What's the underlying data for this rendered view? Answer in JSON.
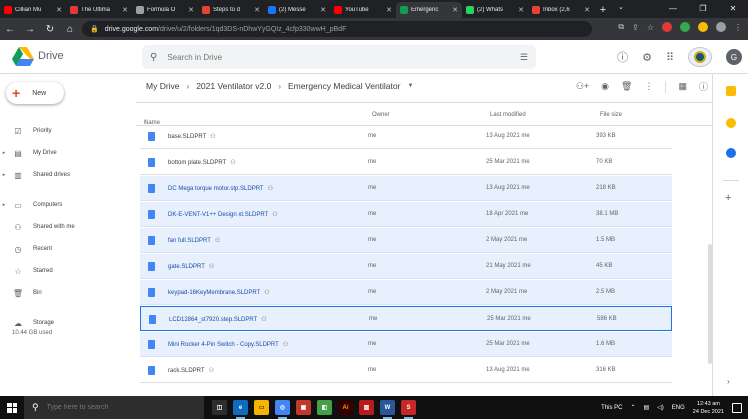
{
  "browser": {
    "tabs": [
      {
        "title": "Cillian Mu",
        "color": "#ff0000",
        "active": false
      },
      {
        "title": "The Ultima",
        "color": "#e53935",
        "active": false
      },
      {
        "title": "Formula O",
        "color": "#9aa0a6",
        "active": false
      },
      {
        "title": "Steps to d",
        "color": "#ea4335",
        "active": false
      },
      {
        "title": "(2) Messe",
        "color": "#1877f2",
        "active": false
      },
      {
        "title": "YouTube",
        "color": "#ff0000",
        "active": false
      },
      {
        "title": "Emergenc",
        "color": "#0f9d58",
        "active": true
      },
      {
        "title": "(2) Whats",
        "color": "#25d366",
        "active": false
      },
      {
        "title": "Inbox (2,6",
        "color": "#ea4335",
        "active": false
      }
    ],
    "url_host": "drive.google.com",
    "url_path": "/drive/u/2/folders/1qd3DS-nDhwYyGQIz_4cfp330wwH_pBdF",
    "window_controls": [
      "—",
      "❐",
      "✕"
    ]
  },
  "drive": {
    "brand": "Drive",
    "search_placeholder": "Search in Drive",
    "avatar_letter": "G"
  },
  "sidebar": {
    "new_label": "New",
    "items": [
      {
        "label": "Priority",
        "icon": "☑",
        "caret": ""
      },
      {
        "label": "My Drive",
        "icon": "▤",
        "caret": "▸"
      },
      {
        "label": "Shared drives",
        "icon": "▥",
        "caret": "▸"
      },
      {
        "label": "Computers",
        "icon": "▭",
        "caret": "▸"
      },
      {
        "label": "Shared with me",
        "icon": "⚇",
        "caret": ""
      },
      {
        "label": "Recent",
        "icon": "◷",
        "caret": ""
      },
      {
        "label": "Starred",
        "icon": "☆",
        "caret": ""
      },
      {
        "label": "Bin",
        "icon": "🗑",
        "caret": ""
      },
      {
        "label": "Storage",
        "icon": "☁",
        "caret": ""
      }
    ],
    "storage_used": "10.44 GB used"
  },
  "breadcrumb": {
    "items": [
      "My Drive",
      "2021 Ventilator v2.0",
      "Emergency Medical Ventilator"
    ],
    "separator": "›"
  },
  "columns": {
    "name": "Name",
    "sort_arrow": "↑",
    "owner": "Owner",
    "modified": "Last modified",
    "size": "File size"
  },
  "files": [
    {
      "name": "base.SLDPRT",
      "owner": "me",
      "modified": "13 Aug 2021 me",
      "size": "393 KB",
      "selected": false
    },
    {
      "name": "bottom plate.SLDPRT",
      "owner": "me",
      "modified": "25 Mar 2021 me",
      "size": "70 KB",
      "selected": false
    },
    {
      "name": "DC Mega torque motor.stp.SLDPRT",
      "owner": "me",
      "modified": "13 Aug 2021 me",
      "size": "218 KB",
      "selected": true
    },
    {
      "name": "DK-E-VENT-V1++ Design xt.SLDPRT",
      "owner": "me",
      "modified": "18 Apr 2021 me",
      "size": "38.1 MB",
      "selected": true
    },
    {
      "name": "fan full.SLDPRT",
      "owner": "me",
      "modified": "2 May 2021 me",
      "size": "1.5 MB",
      "selected": true
    },
    {
      "name": "gate.SLDPRT",
      "owner": "me",
      "modified": "21 May 2021 me",
      "size": "45 KB",
      "selected": true
    },
    {
      "name": "keypad-16KeyMembrane.SLDPRT",
      "owner": "me",
      "modified": "2 May 2021 me",
      "size": "2.5 MB",
      "selected": true
    },
    {
      "name": "LCD12864_st7920.step.SLDPRT",
      "owner": "me",
      "modified": "25 Mar 2021 me",
      "size": "586 KB",
      "selected": true
    },
    {
      "name": "Mini Rocker 4-Pin Switch - Copy.SLDPRT",
      "owner": "me",
      "modified": "25 Mar 2021 me",
      "size": "1.6 MB",
      "selected": true
    },
    {
      "name": "rack.SLDPRT",
      "owner": "me",
      "modified": "13 Aug 2021 me",
      "size": "316 KB",
      "selected": false
    }
  ],
  "taskbar": {
    "search_placeholder": "Type here to search",
    "this_pc": "This PC",
    "lang": "ENG",
    "time": "12:43 am",
    "date": "24 Dec 2021"
  }
}
